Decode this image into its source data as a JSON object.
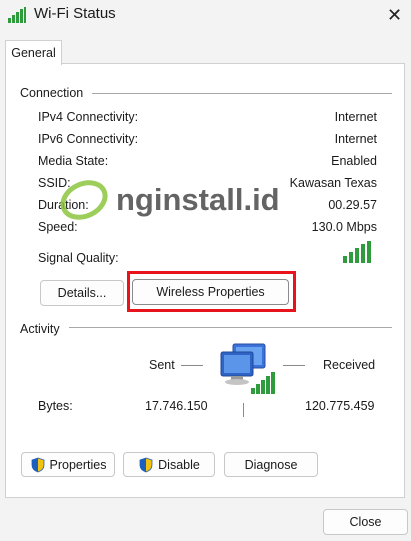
{
  "window": {
    "title": "Wi-Fi Status",
    "close_glyph": "✕",
    "icon": "wifi-signal-icon"
  },
  "tabs": [
    {
      "label": "General"
    }
  ],
  "connection": {
    "heading": "Connection",
    "rows": [
      {
        "label": "IPv4 Connectivity:",
        "value": "Internet"
      },
      {
        "label": "IPv6 Connectivity:",
        "value": "Internet"
      },
      {
        "label": "Media State:",
        "value": "Enabled"
      },
      {
        "label": "SSID:",
        "value": "Kawasan Texas"
      },
      {
        "label": "Duration:",
        "value": "00.29.57"
      },
      {
        "label": "Speed:",
        "value": "130.0 Mbps"
      }
    ],
    "signal_label": "Signal Quality:",
    "signal_bars": 5,
    "signal_color": "#2e9c3c",
    "details_button": "Details...",
    "wireless_button": "Wireless Properties",
    "highlight_color": "#e8141c"
  },
  "watermark": {
    "text": "nginstall.id",
    "brand_colors": [
      "#8cc63f",
      "#4a4a4a"
    ]
  },
  "activity": {
    "heading": "Activity",
    "sent_label": "Sent",
    "received_label": "Received",
    "bytes_label": "Bytes:",
    "bytes_sent": "17.746.150",
    "bytes_received": "120.775.459",
    "icon": "network-computers-icon"
  },
  "buttons": {
    "properties": "Properties",
    "disable": "Disable",
    "diagnose": "Diagnose",
    "close": "Close",
    "shield_icon": "uac-shield-icon"
  }
}
